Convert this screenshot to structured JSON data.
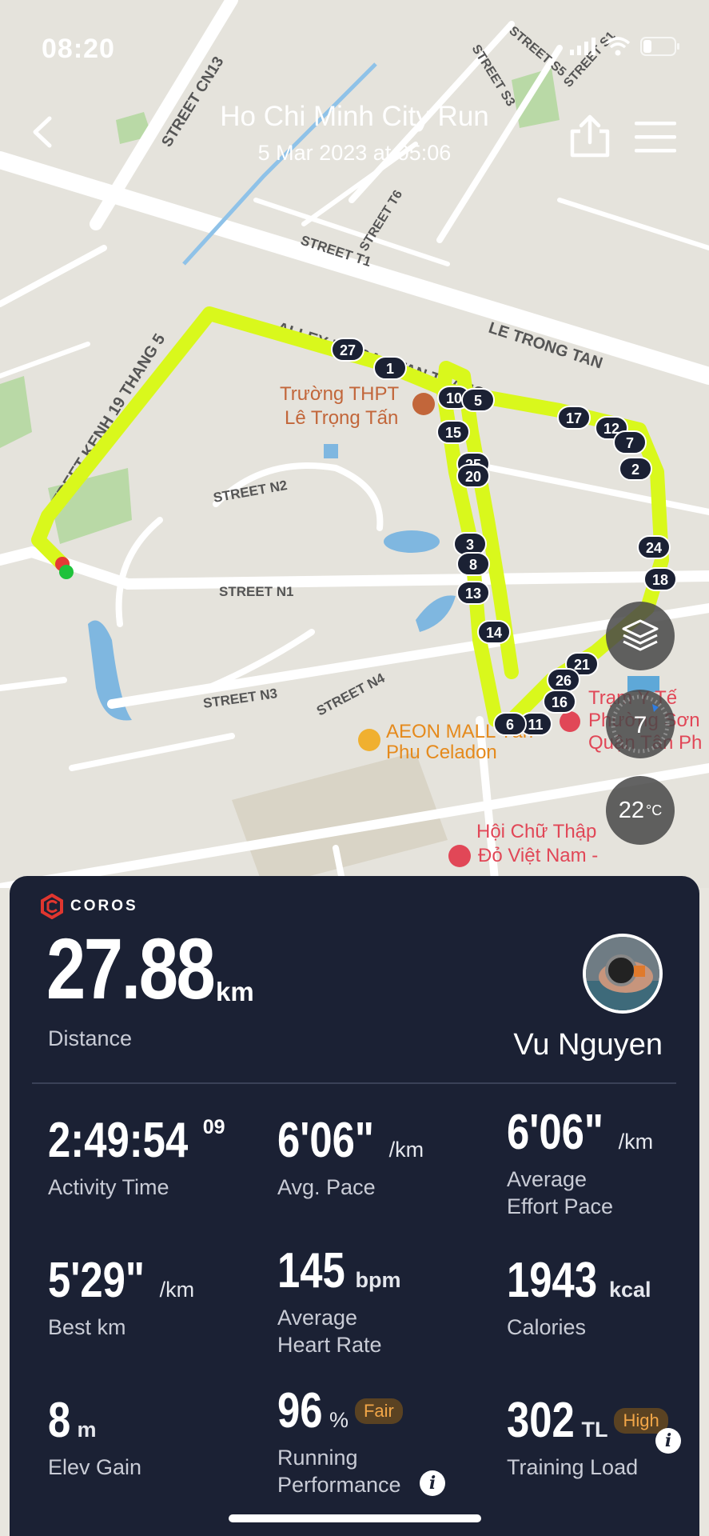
{
  "status_bar": {
    "time": "08:20"
  },
  "header": {
    "title": "Ho Chi Minh City Run",
    "subtitle": "5 Mar 2023 at 05:06"
  },
  "map": {
    "streets": [
      "STREET CN13",
      "STREET S5",
      "STREET S3",
      "STREET S1",
      "STREET T6",
      "STREET T1",
      "LE TRONG TAN",
      "ALLEY BO BAO TAN THANG",
      "STREET KENH 19 THANG 5",
      "STREET N2",
      "STREET N1",
      "STREET N3",
      "STREET N4"
    ],
    "pois": [
      {
        "name_line1": "Trường THPT",
        "name_line2": "Lê Trọng Tấn"
      },
      {
        "name_line1": "AEON MALL Tân",
        "name_line2": "Phu Celadon"
      },
      {
        "name_line1": "Trạm Y Tế",
        "name_line2": "Phường Sơn",
        "name_line3": "Quận Tân Ph"
      },
      {
        "name_line1": "Hội Chữ Thập",
        "name_line2": "Đỏ Việt Nam -"
      }
    ],
    "km_markers": [
      "27",
      "1",
      "10",
      "5",
      "15",
      "25",
      "20",
      "17",
      "12",
      "7",
      "2",
      "3",
      "8",
      "13",
      "18",
      "24",
      "14",
      "21",
      "26",
      "16",
      "11",
      "6"
    ],
    "compass_value": "7",
    "temperature": "22",
    "temperature_unit": "°C",
    "route_color": "#d9f81c"
  },
  "card": {
    "brand": "COROS",
    "distance": {
      "value": "27.88",
      "unit": "km",
      "label": "Distance"
    },
    "user_name": "Vu Nguyen",
    "stats": [
      {
        "value": "2:49:54",
        "sup": "09",
        "unit": "",
        "label": "Activity Time"
      },
      {
        "value": "6'06\"",
        "unit": "/km",
        "label": "Avg. Pace"
      },
      {
        "value": "6'06\"",
        "unit": "/km",
        "label_line1": "Average",
        "label_line2": "Effort Pace"
      },
      {
        "value": "5'29\"",
        "unit": "/km",
        "label": "Best km"
      },
      {
        "value": "145",
        "unit": "bpm",
        "label_line1": "Average",
        "label_line2": "Heart Rate"
      },
      {
        "value": "1943",
        "unit": "kcal",
        "label": "Calories"
      },
      {
        "value": "8",
        "unit": "m",
        "label": "Elev Gain"
      },
      {
        "value": "96",
        "unit": "%",
        "badge": "Fair",
        "label_line1": "Running",
        "label_line2": "Performance"
      },
      {
        "value": "302",
        "unit": "TL",
        "badge": "High",
        "label": "Training Load"
      }
    ],
    "info_glyph": "i"
  }
}
